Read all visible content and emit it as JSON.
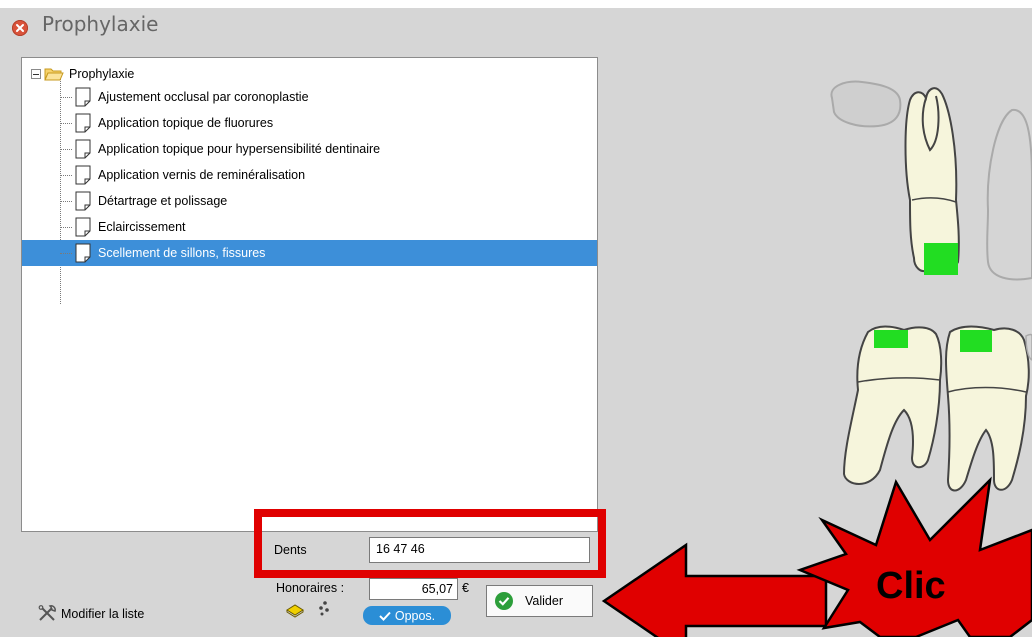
{
  "window": {
    "title": "Prophylaxie"
  },
  "tree": {
    "root_label": "Prophylaxie",
    "items": [
      {
        "label": "Ajustement occlusal par coronoplastie"
      },
      {
        "label": "Application topique de fluorures"
      },
      {
        "label": "Application topique pour hypersensibilité dentinaire"
      },
      {
        "label": "Application vernis de reminéralisation"
      },
      {
        "label": "Détartrage et polissage"
      },
      {
        "label": "Eclaircissement"
      },
      {
        "label": "Scellement de sillons, fissures",
        "selected": true
      }
    ]
  },
  "form": {
    "dents_label": "Dents",
    "dents_value": "16 47 46",
    "honoraires_label": "Honoraires :",
    "honoraires_value": "65,07",
    "currency": "€",
    "valider_label": "Valider",
    "oppos_label": "Oppos.",
    "modifier_label": "Modifier la liste"
  },
  "annotation": {
    "text": "Clic"
  },
  "colors": {
    "selection": "#3d8fd9",
    "highlight_frame": "#e00000",
    "tooth_fill": "#f6f5dc",
    "tooth_mark": "#22dd22"
  }
}
